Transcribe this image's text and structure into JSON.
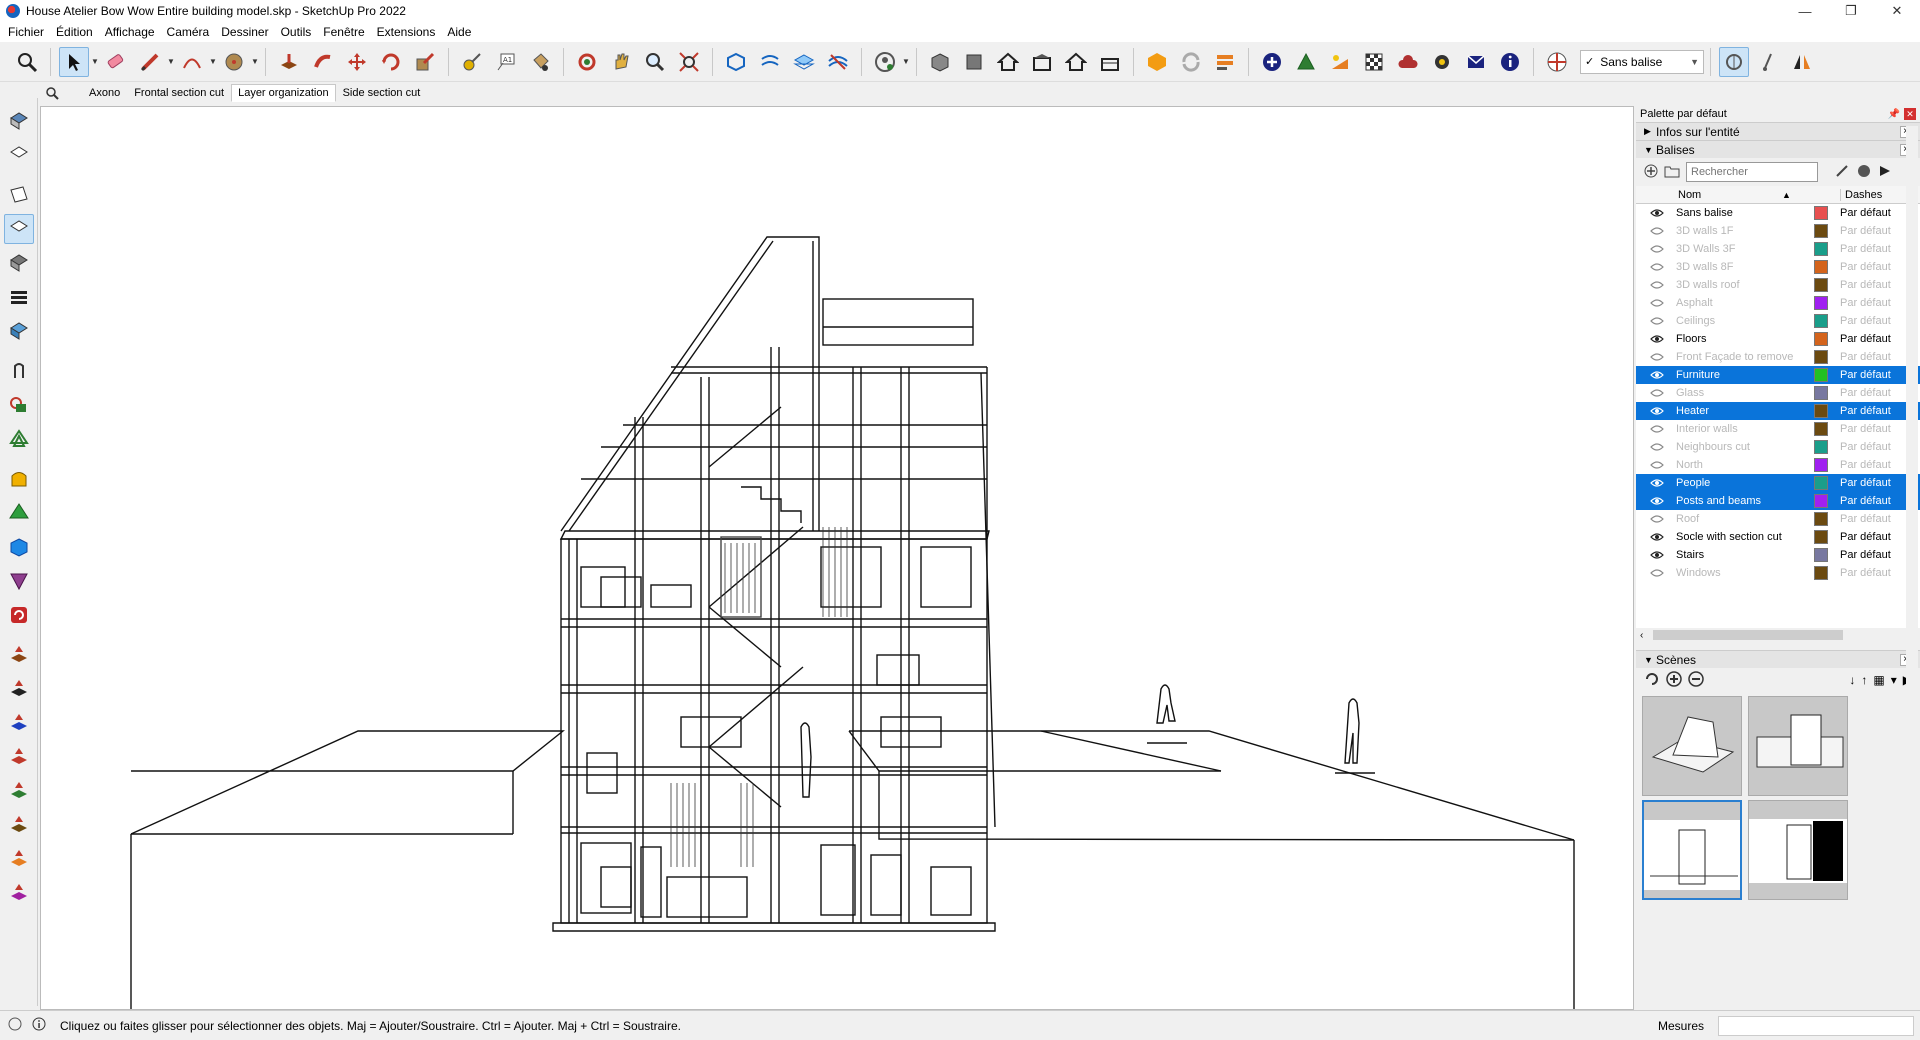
{
  "window": {
    "title": "House Atelier Bow Wow Entire building model.skp - SketchUp Pro 2022",
    "controls": [
      "—",
      "❐",
      "✕"
    ]
  },
  "menu": [
    "Fichier",
    "Édition",
    "Affichage",
    "Caméra",
    "Dessiner",
    "Outils",
    "Fenêtre",
    "Extensions",
    "Aide"
  ],
  "toolbar": {
    "style_select_label": "Sans balise",
    "icons": [
      "search-icon",
      "select-icon",
      "eraser-icon",
      "pencil-icon",
      "arc-icon",
      "circle-icon",
      "paint-bucket-icon",
      "push-pull-icon",
      "move-icon",
      "rotate-icon",
      "scale-icon",
      "tape-measure-icon",
      "text-icon",
      "orbit-icon",
      "pan-icon",
      "zoom-icon",
      "zoom-extents-icon",
      "section-plane-icon",
      "house-icon"
    ]
  },
  "scene_tabs": [
    "Axono",
    "Frontal section cut",
    "Layer organization",
    "Side section cut"
  ],
  "scene_tabs_active": "Layer organization",
  "tray": {
    "title": "Palette par défaut",
    "entity_info": "Infos sur l'entité",
    "tags_section": "Balises",
    "search_placeholder": "Rechercher",
    "col_name": "Nom",
    "col_dashes": "Dashes",
    "scenes_section": "Scènes"
  },
  "tags": [
    {
      "name": "Sans balise",
      "dash": "Par défaut",
      "color": "#e85050",
      "visible": true,
      "selected": false
    },
    {
      "name": "3D walls 1F",
      "dash": "Par défaut",
      "color": "#6b4a10",
      "visible": false,
      "selected": false
    },
    {
      "name": "3D Walls 3F",
      "dash": "Par défaut",
      "color": "#1a9e8a",
      "visible": false,
      "selected": false
    },
    {
      "name": "3D walls 8F",
      "dash": "Par défaut",
      "color": "#d4641c",
      "visible": false,
      "selected": false
    },
    {
      "name": "3D walls roof",
      "dash": "Par défaut",
      "color": "#6b4a10",
      "visible": false,
      "selected": false
    },
    {
      "name": "Asphalt",
      "dash": "Par défaut",
      "color": "#a020f0",
      "visible": false,
      "selected": false
    },
    {
      "name": "Ceilings",
      "dash": "Par défaut",
      "color": "#1a9e8a",
      "visible": false,
      "selected": false
    },
    {
      "name": "Floors",
      "dash": "Par défaut",
      "color": "#d4641c",
      "visible": true,
      "selected": false
    },
    {
      "name": "Front Façade to remove",
      "dash": "Par défaut",
      "color": "#6b4a10",
      "visible": false,
      "selected": false
    },
    {
      "name": "Furniture",
      "dash": "Par défaut",
      "color": "#22c022",
      "visible": true,
      "selected": true
    },
    {
      "name": "Glass",
      "dash": "Par défaut",
      "color": "#7878a0",
      "visible": false,
      "selected": false
    },
    {
      "name": "Heater",
      "dash": "Par défaut",
      "color": "#6b4a10",
      "visible": true,
      "selected": true
    },
    {
      "name": "Interior walls",
      "dash": "Par défaut",
      "color": "#6b4a10",
      "visible": false,
      "selected": false
    },
    {
      "name": "Neighbours cut",
      "dash": "Par défaut",
      "color": "#1a9e8a",
      "visible": false,
      "selected": false
    },
    {
      "name": "North",
      "dash": "Par défaut",
      "color": "#a020f0",
      "visible": false,
      "selected": false
    },
    {
      "name": "People",
      "dash": "Par défaut",
      "color": "#1a9e8a",
      "visible": true,
      "selected": true
    },
    {
      "name": "Posts and beams",
      "dash": "Par défaut",
      "color": "#a020f0",
      "visible": true,
      "selected": true
    },
    {
      "name": "Roof",
      "dash": "Par défaut",
      "color": "#6b4a10",
      "visible": false,
      "selected": false
    },
    {
      "name": "Socle with section cut",
      "dash": "Par défaut",
      "color": "#6b4a10",
      "visible": true,
      "selected": false
    },
    {
      "name": "Stairs",
      "dash": "Par défaut",
      "color": "#7878a0",
      "visible": true,
      "selected": false
    },
    {
      "name": "Windows",
      "dash": "Par défaut",
      "color": "#6b4a10",
      "visible": false,
      "selected": false
    }
  ],
  "status": {
    "hint": "Cliquez ou faites glisser pour sélectionner des objets. Maj = Ajouter/Soustraire. Ctrl = Ajouter. Maj + Ctrl = Soustraire.",
    "measure_label": "Mesures"
  }
}
